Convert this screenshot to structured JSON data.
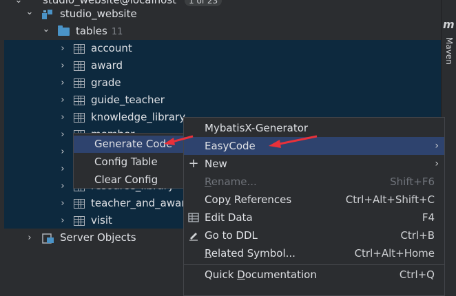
{
  "tree": {
    "top_cut_label": "studio_website@localhost",
    "top_cut_badge": "1 of 23",
    "schema": "studio_website",
    "tables_folder": "tables",
    "tables_count": "11",
    "tables": [
      "account",
      "award",
      "grade",
      "guide_teacher",
      "knowledge_library",
      "member",
      "",
      "",
      "resource_library",
      "teacher_and_award",
      "visit"
    ],
    "server_objects": "Server Objects"
  },
  "side_panel": {
    "logo": "m",
    "label": "Maven"
  },
  "submenu": {
    "items": [
      "Generate Code",
      "Config Table",
      "Clear Config"
    ]
  },
  "context_menu": {
    "items": [
      {
        "label": "MybatisX-Generator",
        "shortcut": ""
      },
      {
        "label": "EasyCode",
        "shortcut": "",
        "submenu": "›"
      },
      {
        "label": "New",
        "shortcut": "",
        "submenu": "›"
      },
      {
        "label_pre": "",
        "label_ul": "R",
        "label_post": "ename...",
        "shortcut": "Shift+F6"
      },
      {
        "label_pre": "Cop",
        "label_ul": "y",
        "label_post": " References",
        "shortcut": "Ctrl+Alt+Shift+C"
      },
      {
        "label": "Edit Data",
        "shortcut": "F4"
      },
      {
        "label": "Go to DDL",
        "shortcut": "Ctrl+B"
      },
      {
        "label_pre": "",
        "label_ul": "R",
        "label_post": "elated Symbol...",
        "shortcut": "Ctrl+Alt+Home"
      },
      {
        "label_pre": "Quick ",
        "label_ul": "D",
        "label_post": "ocumentation",
        "shortcut": "Ctrl+Q"
      }
    ]
  },
  "colors": {
    "background": "#2b2d30",
    "selection": "#0d293e",
    "menu_highlight": "#2e436e",
    "annotation_arrow": "#e8313a"
  }
}
